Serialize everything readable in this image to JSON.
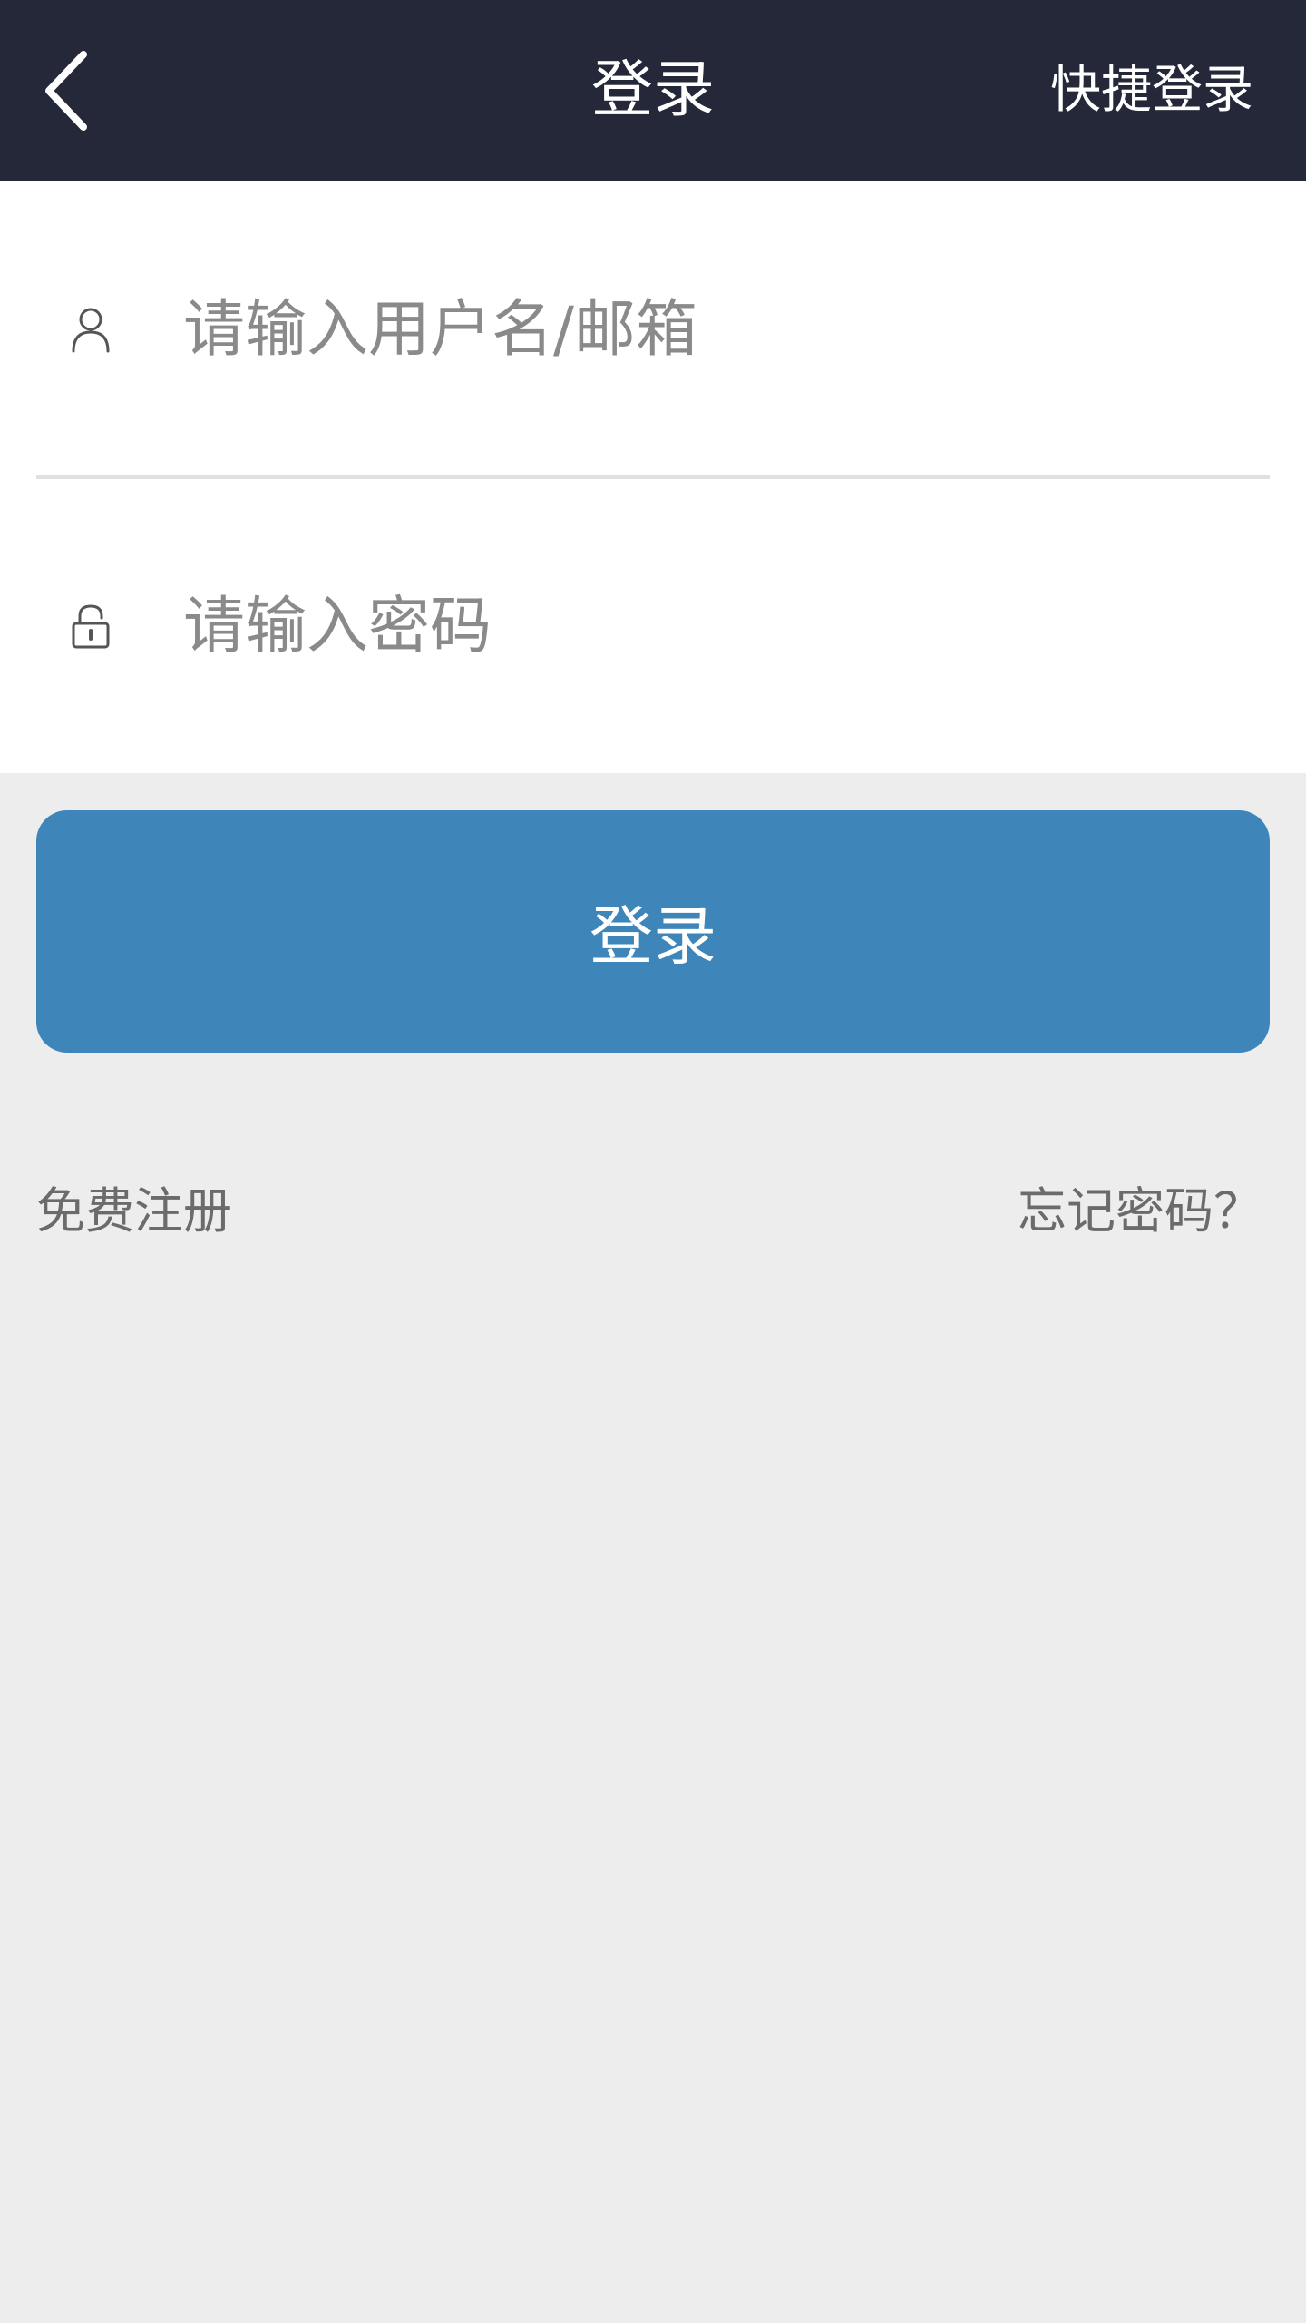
{
  "header": {
    "title": "登录",
    "quick_login_label": "快捷登录",
    "back_icon": "chevron-left-icon"
  },
  "form": {
    "username": {
      "placeholder": "请输入用户名/邮箱",
      "value": "",
      "icon": "user-icon"
    },
    "password": {
      "placeholder": "请输入密码",
      "value": "",
      "icon": "lock-icon"
    }
  },
  "login_button_label": "登录",
  "links": {
    "register": "免费注册",
    "forgot_password": "忘记密码？"
  },
  "colors": {
    "header_bg": "#242838",
    "accent": "#3e86b9",
    "page_bg": "#ededed"
  }
}
